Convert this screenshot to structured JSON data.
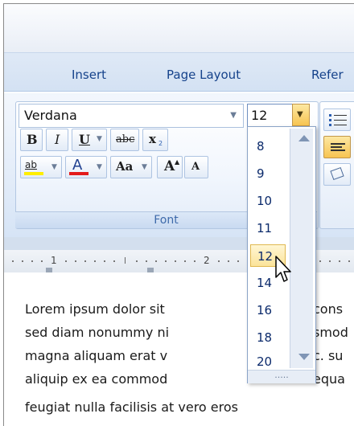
{
  "ribbon": {
    "tabs": [
      {
        "label": "Insert"
      },
      {
        "label": "Page Layout"
      },
      {
        "label": "Refer"
      }
    ],
    "font_group": {
      "font_name": "Verdana",
      "font_size": "12",
      "bold": "B",
      "italic": "I",
      "underline": "U",
      "strikethrough": "abc",
      "subscript": "x",
      "grow_font": "A",
      "shrink_font": "A",
      "change_case": "Aa",
      "highlight": "ab",
      "font_color": "A",
      "label": "Font",
      "colors": {
        "font_color_bar": "#e31b1b",
        "highlight_bar": "#ffee00"
      }
    }
  },
  "ruler": {
    "marks": [
      "1",
      "2"
    ]
  },
  "size_dropdown": {
    "options": [
      "8",
      "9",
      "10",
      "11",
      "12",
      "14",
      "16",
      "18",
      "20"
    ],
    "selected": "12",
    "grip": "....."
  },
  "document": {
    "lines": [
      "Lorem ipsum dolor sit",
      "sed diam nonummy ni",
      "magna aliquam erat v",
      "aliquip ex ea commod",
      "feugiat nulla facilisis at vero eros"
    ],
    "lines_right": [
      "cons",
      "smod",
      "c.  su",
      "equa"
    ]
  },
  "icons": [
    "dropdown-arrow-icon",
    "mouse-cursor-icon",
    "bullets-icon",
    "shading-icon"
  ]
}
